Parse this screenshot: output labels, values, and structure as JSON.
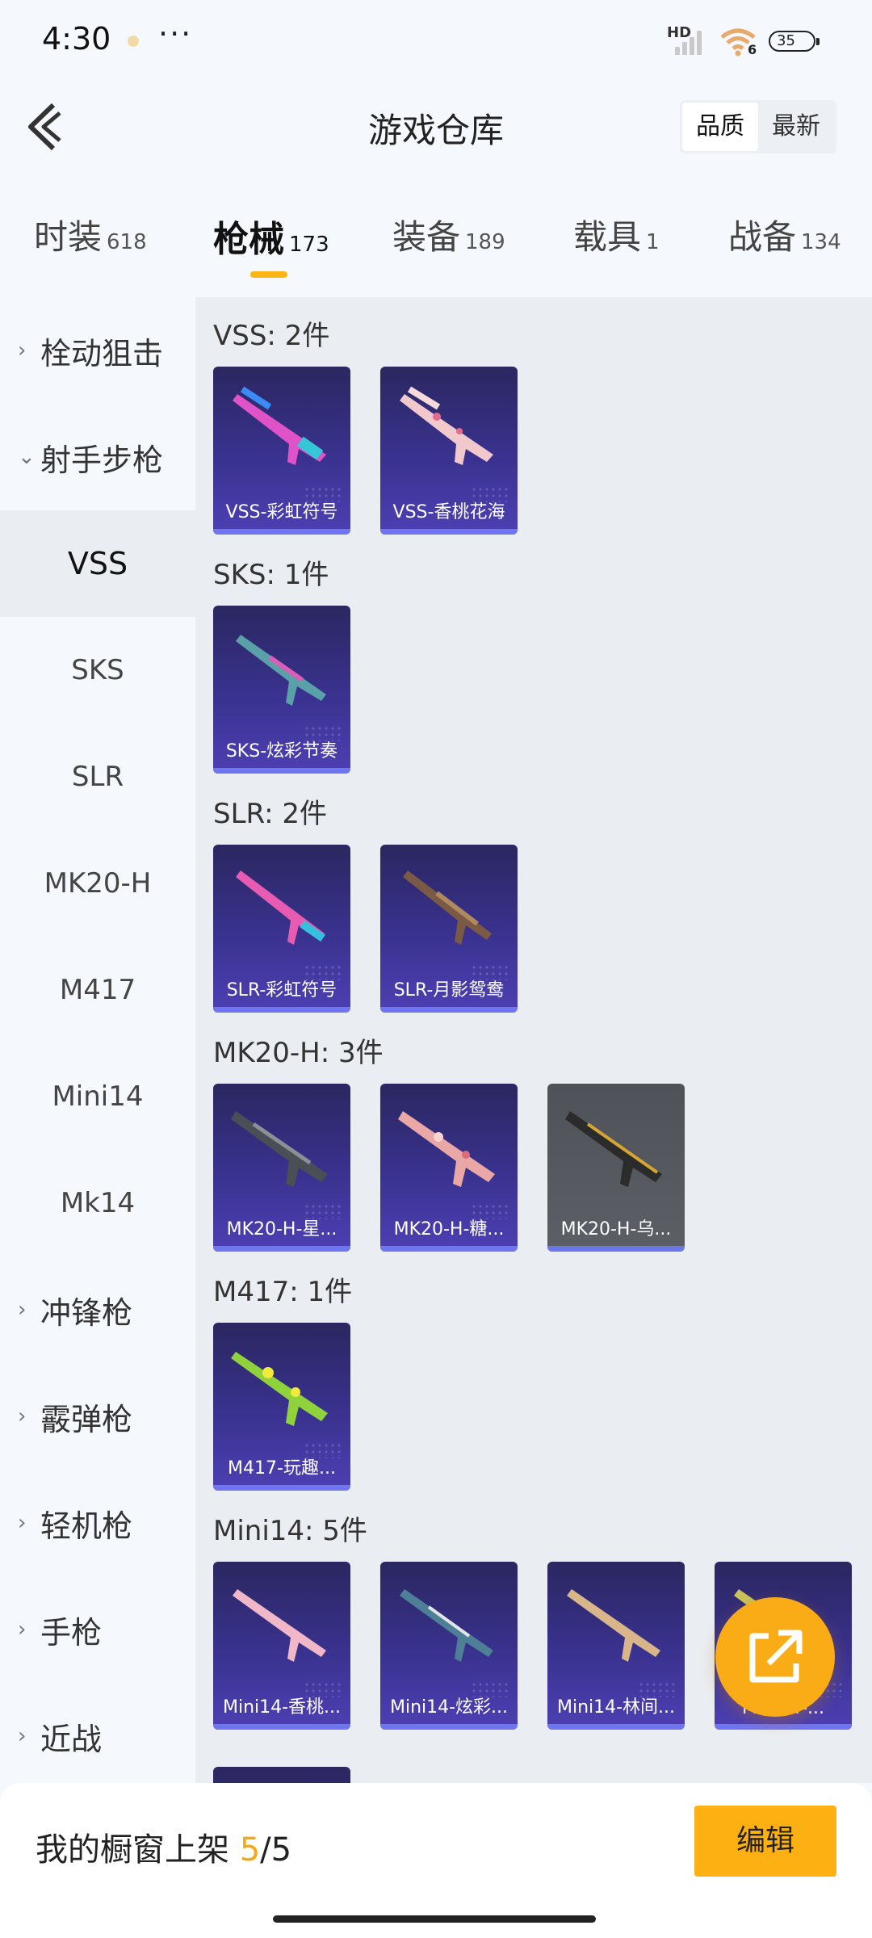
{
  "status_bar": {
    "time": "4:30",
    "more": "···",
    "network": "HD",
    "wifi_badge": "6",
    "battery": "35"
  },
  "header": {
    "title": "游戏仓库",
    "sort_options": [
      "品质",
      "最新"
    ],
    "active_sort": "品质"
  },
  "tabs": [
    {
      "label": "时装",
      "count": "618"
    },
    {
      "label": "枪械",
      "count": "173",
      "active": true
    },
    {
      "label": "装备",
      "count": "189"
    },
    {
      "label": "载具",
      "count": "1"
    },
    {
      "label": "战备",
      "count": "134"
    }
  ],
  "sidebar": {
    "categories": [
      "栓动狙击",
      "射手步枪",
      "冲锋枪",
      "霰弹枪",
      "轻机枪",
      "手枪",
      "近战"
    ],
    "sub_items": [
      "VSS",
      "SKS",
      "SLR",
      "MK20-H",
      "M417",
      "Mini14",
      "Mk14"
    ],
    "active_sub": "VSS"
  },
  "groups": [
    {
      "title": "VSS: 2件",
      "items": [
        "VSS-彩虹符号",
        "VSS-香桃花海"
      ]
    },
    {
      "title": "SKS: 1件",
      "items": [
        "SKS-炫彩节奏"
      ]
    },
    {
      "title": "SLR: 2件",
      "items": [
        "SLR-彩虹符号",
        "SLR-月影鸳鸯"
      ]
    },
    {
      "title": "MK20-H: 3件",
      "items": [
        "MK20-H-星...",
        "MK20-H-糖...",
        "MK20-H-乌..."
      ]
    },
    {
      "title": "M417: 1件",
      "items": [
        "M417-玩趣..."
      ]
    },
    {
      "title": "Mini14: 5件",
      "items": [
        "Mini14-香桃...",
        "Mini14-炫彩...",
        "Mini14-林间...",
        "Mini14-..."
      ]
    }
  ],
  "bottom_bar": {
    "label": "我的橱窗上架",
    "current": "5",
    "total": "/5",
    "edit_button": "编辑"
  },
  "colors": {
    "accent": "#fcb012",
    "card_bg": "#3a3290",
    "card_line": "#6f74ef"
  }
}
